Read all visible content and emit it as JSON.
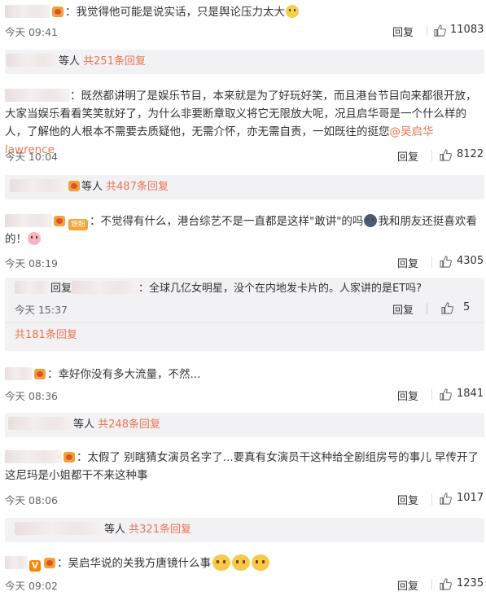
{
  "comments": [
    {
      "text": "：我觉得他可能是说实话，只是舆论压力太大",
      "time": "今天 09:41",
      "reply_label": "回复",
      "likes": "11083",
      "summary_suffix": "等人",
      "summary_count": "共251条回复"
    },
    {
      "text_a": "：既然都讲明了是娱乐节目，本来就是为了好玩好笑，而且港台节目向来都很开放，大家当娱乐看看笑笑就好了，为什么非要断章取义将它无限放大呢，况且启华哥是一个什么样的人，了解他的人根本不需要去质疑他，无需介怀，亦无需自责，一如既往的挺您",
      "mention": "@吴启华lawrence",
      "time": "今天 10:04",
      "reply_label": "回复",
      "likes": "8122",
      "summary_suffix": "等人",
      "summary_count": "共487条回复"
    },
    {
      "badge": "铁粉",
      "text_a": "：不觉得有什么，港台综艺不是一直都是这样\"敢讲\"的吗",
      "text_b": "我和朋友还挺喜欢看的！",
      "time": "今天 08:19",
      "reply_label": "回复",
      "likes": "4305",
      "sub_reply": {
        "prefix": "回复",
        "text": "：全球几亿女明星，没个在内地发卡片的。人家讲的是ET吗?",
        "time": "今天 15:37",
        "reply_label": "回复",
        "likes": "5"
      },
      "more": "共181条回复"
    },
    {
      "text": "：幸好你没有多大流量，不然...",
      "time": "今天 08:36",
      "reply_label": "回复",
      "likes": "1841",
      "summary_suffix": "等人",
      "summary_count": "共248条回复"
    },
    {
      "text": "：太假了 别瞎猜女演员名字了...要真有女演员干这种给全剧组房号的事儿 早传开了 这尼玛是小姐都干不来这种事",
      "time": "今天 08:06",
      "reply_label": "回复",
      "likes": "1017",
      "summary_suffix": "等人",
      "summary_count": "共321条回复"
    },
    {
      "vbadge": "V",
      "text": "：吴启华说的关我方唐镜什么事",
      "time": "今天 09:02",
      "reply_label": "回复",
      "likes": "1235"
    }
  ],
  "colors": {
    "accent": "#eb7350",
    "summary_bg": "#f2f2f5",
    "text": "#333333",
    "meta": "#666666"
  }
}
